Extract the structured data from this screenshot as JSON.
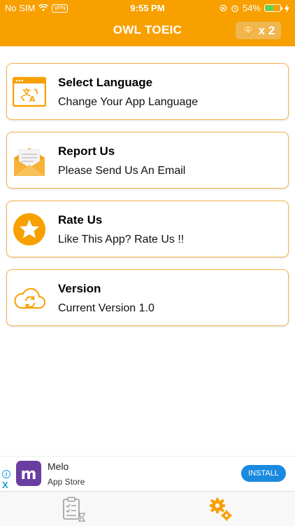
{
  "status": {
    "carrier": "No SIM",
    "vpn": "VPN",
    "time": "9:55 PM",
    "battery": "54%",
    "battery_level": 0.54
  },
  "header": {
    "title": "OWL TOEIC",
    "gem_count": "x 2"
  },
  "menu": [
    {
      "title": "Select Language",
      "subtitle": "Change Your App Language",
      "icon": "translate-icon"
    },
    {
      "title": "Report Us",
      "subtitle": "Please Send Us An Email",
      "icon": "envelope-icon"
    },
    {
      "title": "Rate Us",
      "subtitle": "Like This App? Rate Us !!",
      "icon": "star-icon"
    },
    {
      "title": "Version",
      "subtitle": "Current Version 1.0",
      "icon": "cloud-sync-icon"
    }
  ],
  "ad": {
    "app_name": "Melo",
    "store": "App Store",
    "install": "INSTALL",
    "info": "i",
    "close": "X",
    "logo_letter": "m"
  },
  "tabs": [
    {
      "name": "checklist",
      "icon": "checklist-icon"
    },
    {
      "name": "settings",
      "icon": "gears-icon"
    }
  ],
  "colors": {
    "primary": "#f7a000",
    "card_border": "#f5b24a",
    "install_blue": "#1a8ae0"
  }
}
